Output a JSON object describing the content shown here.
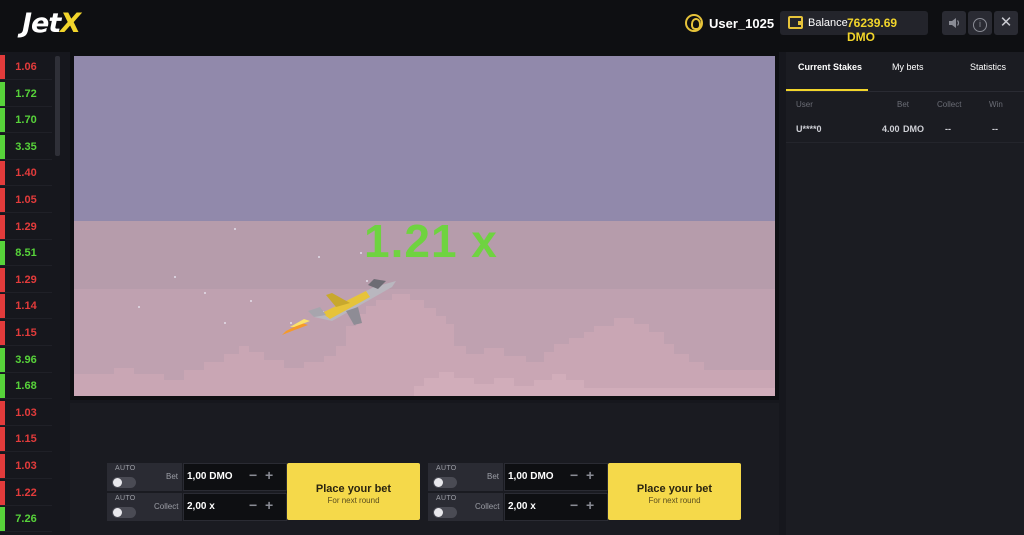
{
  "header": {
    "logo_main": "Jet",
    "logo_accent": "X",
    "username": "User_1025",
    "balance_label": "Balance",
    "balance_value": "76239.69 DMO"
  },
  "history": [
    {
      "value": "1.06",
      "status": "red"
    },
    {
      "value": "1.72",
      "status": "green"
    },
    {
      "value": "1.70",
      "status": "green"
    },
    {
      "value": "3.35",
      "status": "green"
    },
    {
      "value": "1.40",
      "status": "red"
    },
    {
      "value": "1.05",
      "status": "red"
    },
    {
      "value": "1.29",
      "status": "red"
    },
    {
      "value": "8.51",
      "status": "green"
    },
    {
      "value": "1.29",
      "status": "red"
    },
    {
      "value": "1.14",
      "status": "red"
    },
    {
      "value": "1.15",
      "status": "red"
    },
    {
      "value": "3.96",
      "status": "green"
    },
    {
      "value": "1.68",
      "status": "green"
    },
    {
      "value": "1.03",
      "status": "red"
    },
    {
      "value": "1.15",
      "status": "red"
    },
    {
      "value": "1.03",
      "status": "red"
    },
    {
      "value": "1.22",
      "status": "red"
    },
    {
      "value": "7.26",
      "status": "green"
    }
  ],
  "game": {
    "multiplier": "1.21 x"
  },
  "stakes_panel": {
    "tabs": [
      "Current Stakes",
      "My bets",
      "Statistics"
    ],
    "active_tab": 0,
    "columns": {
      "user": "User",
      "bet": "Bet",
      "collect": "Collect",
      "win": "Win"
    },
    "rows": [
      {
        "user": "U****0",
        "bet": "4.00",
        "currency": "DMO",
        "collect": "--",
        "win": "--"
      }
    ]
  },
  "bet_panels": [
    {
      "auto_label": "AUTO",
      "bet_label": "Bet",
      "bet_value": "1,00 DMO",
      "collect_label": "Collect",
      "collect_value": "2,00 x",
      "button_title": "Place your bet",
      "button_subtitle": "For next round"
    },
    {
      "auto_label": "AUTO",
      "bet_label": "Bet",
      "bet_value": "1,00 DMO",
      "collect_label": "Collect",
      "collect_value": "2,00 x",
      "button_title": "Place your bet",
      "button_subtitle": "For next round"
    }
  ],
  "colors": {
    "accent": "#f2d52b",
    "loss": "#e23b3b",
    "win": "#57d33a",
    "multiplier": "#6fd340"
  },
  "icons": [
    "user-icon",
    "wallet-icon",
    "sound-icon",
    "info-icon",
    "close-icon",
    "jet-icon",
    "minus-icon",
    "plus-icon"
  ]
}
